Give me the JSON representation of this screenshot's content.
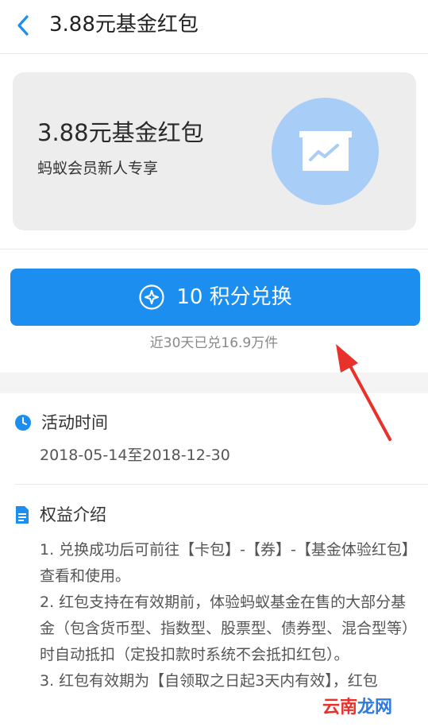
{
  "nav": {
    "title": "3.88元基金红包"
  },
  "card": {
    "title": "3.88元基金红包",
    "subtitle": "蚂蚁会员新人专享"
  },
  "redeem": {
    "label": "10 积分兑换",
    "note": "近30天已兑16.9万件"
  },
  "activity": {
    "heading": "活动时间",
    "period": "2018-05-14至2018-12-30"
  },
  "benefits": {
    "heading": "权益介绍",
    "items": [
      "1. 兑换成功后可前往【卡包】-【券】-【基金体验红包】查看和使用。",
      "2. 红包支持在有效期前，体验蚂蚁基金在售的大部分基金（包含货币型、指数型、股票型、债券型、混合型等）时自动抵扣（定投扣款时系统不会抵扣红包）。",
      "3. 红包有效期为【自领取之日起3天内有效】，红包"
    ]
  },
  "watermark": {
    "part1": "云南",
    "part2": "龙网"
  },
  "colors": {
    "primary": "#1b8ef0",
    "card_bg": "#ededed",
    "icon_circle": "#a8cdf7",
    "annotation_arrow": "#e8312a"
  }
}
